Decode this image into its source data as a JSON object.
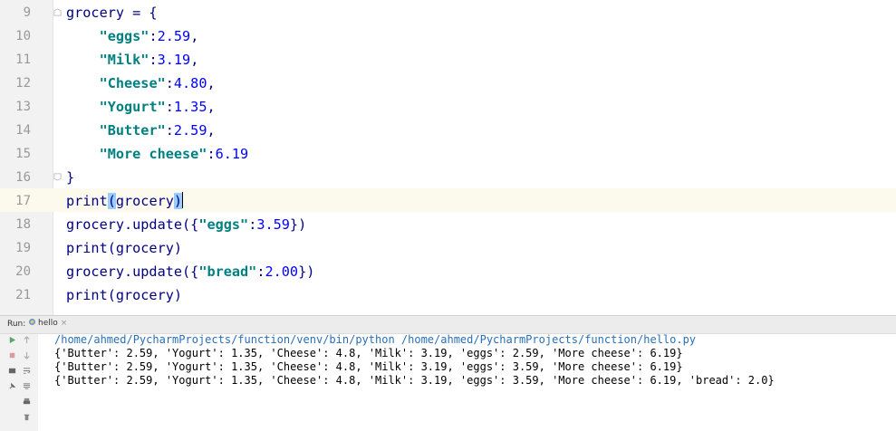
{
  "editor": {
    "lines": [
      {
        "no": "9",
        "parts": [
          {
            "t": "grocery = {",
            "c": "plain"
          }
        ]
      },
      {
        "no": "10",
        "parts": [
          {
            "t": "    ",
            "c": "plain"
          },
          {
            "t": "\"eggs\"",
            "c": "str"
          },
          {
            "t": ":",
            "c": "plain"
          },
          {
            "t": "2.59",
            "c": "num"
          },
          {
            "t": ",",
            "c": "plain"
          }
        ]
      },
      {
        "no": "11",
        "parts": [
          {
            "t": "    ",
            "c": "plain"
          },
          {
            "t": "\"Milk\"",
            "c": "str"
          },
          {
            "t": ":",
            "c": "plain"
          },
          {
            "t": "3.19",
            "c": "num"
          },
          {
            "t": ",",
            "c": "plain"
          }
        ]
      },
      {
        "no": "12",
        "parts": [
          {
            "t": "    ",
            "c": "plain"
          },
          {
            "t": "\"Cheese\"",
            "c": "str"
          },
          {
            "t": ":",
            "c": "plain"
          },
          {
            "t": "4.80",
            "c": "num"
          },
          {
            "t": ",",
            "c": "plain"
          }
        ]
      },
      {
        "no": "13",
        "parts": [
          {
            "t": "    ",
            "c": "plain"
          },
          {
            "t": "\"Yogurt\"",
            "c": "str"
          },
          {
            "t": ":",
            "c": "plain"
          },
          {
            "t": "1.35",
            "c": "num"
          },
          {
            "t": ",",
            "c": "plain"
          }
        ]
      },
      {
        "no": "14",
        "parts": [
          {
            "t": "    ",
            "c": "plain"
          },
          {
            "t": "\"Butter\"",
            "c": "str"
          },
          {
            "t": ":",
            "c": "plain"
          },
          {
            "t": "2.59",
            "c": "num"
          },
          {
            "t": ",",
            "c": "plain"
          }
        ]
      },
      {
        "no": "15",
        "parts": [
          {
            "t": "    ",
            "c": "plain"
          },
          {
            "t": "\"More cheese\"",
            "c": "str"
          },
          {
            "t": ":",
            "c": "plain"
          },
          {
            "t": "6.19",
            "c": "num"
          }
        ]
      },
      {
        "no": "16",
        "parts": [
          {
            "t": "}",
            "c": "plain"
          }
        ]
      },
      {
        "no": "17",
        "current": true,
        "parts": [
          {
            "t": "print",
            "c": "plain"
          },
          {
            "t": "(",
            "c": "hl"
          },
          {
            "t": "grocery",
            "c": "plain"
          },
          {
            "t": ")",
            "c": "hl"
          },
          {
            "t": "",
            "c": "caret"
          }
        ]
      },
      {
        "no": "18",
        "parts": [
          {
            "t": "grocery.update({",
            "c": "plain"
          },
          {
            "t": "\"eggs\"",
            "c": "str"
          },
          {
            "t": ":",
            "c": "plain"
          },
          {
            "t": "3.59",
            "c": "num"
          },
          {
            "t": "})",
            "c": "plain"
          }
        ]
      },
      {
        "no": "19",
        "parts": [
          {
            "t": "print(grocery)",
            "c": "plain"
          }
        ]
      },
      {
        "no": "20",
        "parts": [
          {
            "t": "grocery.update({",
            "c": "plain"
          },
          {
            "t": "\"bread\"",
            "c": "str"
          },
          {
            "t": ":",
            "c": "plain"
          },
          {
            "t": "2.00",
            "c": "num"
          },
          {
            "t": "})",
            "c": "plain"
          }
        ]
      },
      {
        "no": "21",
        "parts": [
          {
            "t": "print(grocery)",
            "c": "plain"
          }
        ]
      }
    ]
  },
  "run": {
    "label": "Run:",
    "tab": "hello",
    "tab_close": "×",
    "output": [
      "/home/ahmed/PycharmProjects/function/venv/bin/python /home/ahmed/PycharmProjects/function/hello.py",
      "{'Butter': 2.59, 'Yogurt': 1.35, 'Cheese': 4.8, 'Milk': 3.19, 'eggs': 2.59, 'More cheese': 6.19}",
      "{'Butter': 2.59, 'Yogurt': 1.35, 'Cheese': 4.8, 'Milk': 3.19, 'eggs': 3.59, 'More cheese': 6.19}",
      "{'Butter': 2.59, 'Yogurt': 1.35, 'Cheese': 4.8, 'Milk': 3.19, 'eggs': 3.59, 'More cheese': 6.19, 'bread': 2.0}"
    ],
    "toolbar_icons": [
      "run-icon",
      "up-arrow-icon",
      "stop-icon",
      "down-arrow-icon",
      "layout-icon",
      "soft-wrap-icon",
      "pin-icon",
      "scroll-to-end-icon",
      "print-icon",
      "delete-icon"
    ],
    "colors": {
      "path": "#2a6fb5",
      "run": "#59a869",
      "stop": "#c75450"
    }
  }
}
